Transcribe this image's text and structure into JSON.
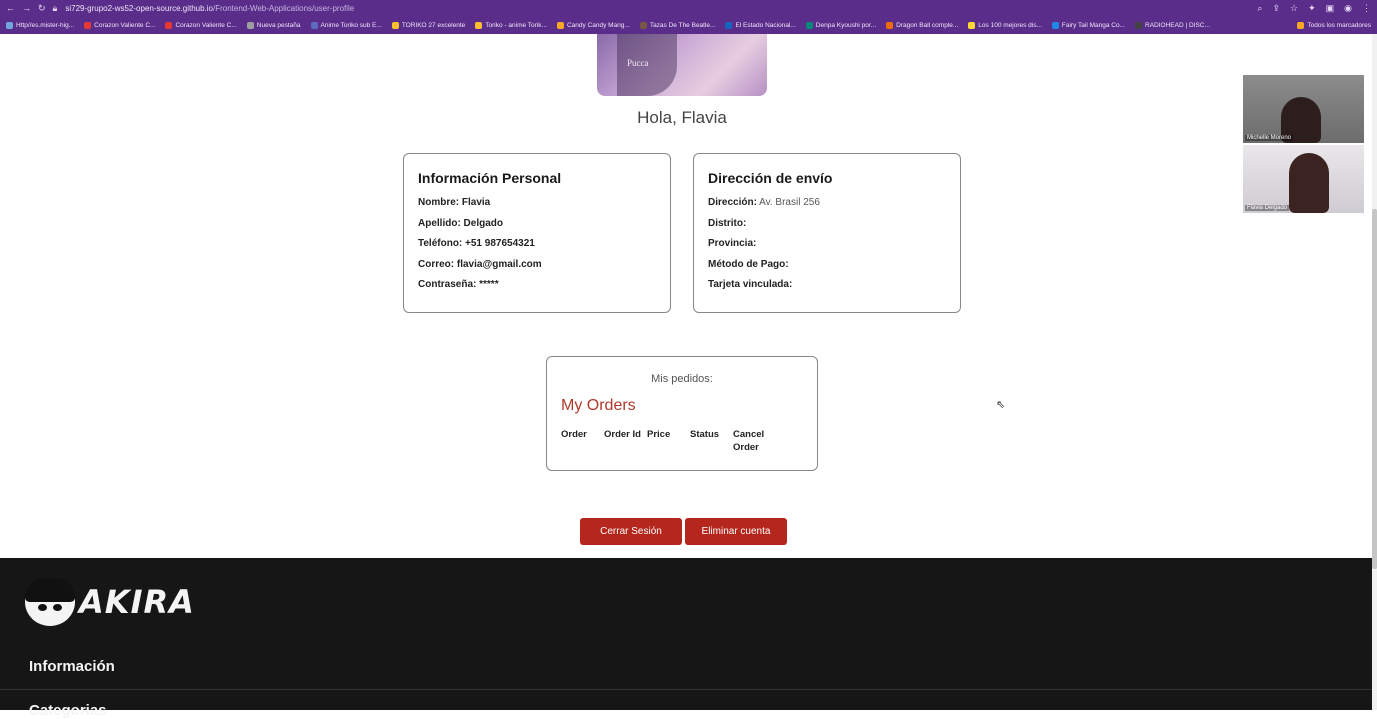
{
  "browser": {
    "url_host": "si729-grupo2-ws52-open-source.github.io",
    "url_path": "/Frontend-Web-Applications/user-profile",
    "bookmarks": [
      {
        "label": "Http//es.mister-hig...",
        "color": "#6fa8dc"
      },
      {
        "label": "Corazon Valiente C...",
        "color": "#e53935"
      },
      {
        "label": "Corazon Valiente C...",
        "color": "#e53935"
      },
      {
        "label": "Nueva pestaña",
        "color": "#9e9e9e"
      },
      {
        "label": "Anime Toriko sub E...",
        "color": "#5c6bc0"
      },
      {
        "label": "TORIKO 27 excelente",
        "color": "#fbc02d"
      },
      {
        "label": "Toriko - anime Torik...",
        "color": "#fbc02d"
      },
      {
        "label": "Candy Candy Mang...",
        "color": "#f9a825"
      },
      {
        "label": "Tazas De The Beatle...",
        "color": "#795548"
      },
      {
        "label": "El Estado Nacional...",
        "color": "#1565c0"
      },
      {
        "label": "Denpa Kyoushi por...",
        "color": "#00897b"
      },
      {
        "label": "Dragon Ball comple...",
        "color": "#ef6c00"
      },
      {
        "label": "Los 100 mejores dis...",
        "color": "#fdd835"
      },
      {
        "label": "Fairy Tail Manga Co...",
        "color": "#1e88e5"
      },
      {
        "label": "RADIOHEAD | DISC...",
        "color": "#424242"
      }
    ],
    "all_bookmarks_label": "Todos los marcadores"
  },
  "profile": {
    "avatar_caption": "Pucca",
    "greeting": "Hola, Flavia"
  },
  "personal_info": {
    "title": "Información Personal",
    "name_label": "Nombre: Flavia",
    "surname_label": "Apellido: Delgado",
    "phone_label": "Teléfono: +51 987654321",
    "email_label": "Correo: flavia@gmail.com",
    "password_label": "Contraseña: *****"
  },
  "shipping": {
    "title": "Dirección de envío",
    "address_label": "Dirección:",
    "address_value": " Av. Brasil 256",
    "district_label": "Distrito:",
    "province_label": "Provincia:",
    "payment_label": "Método de Pago:",
    "card_label": "Tarjeta vinculada:"
  },
  "orders": {
    "caption": "Mis pedidos:",
    "title": "My Orders",
    "columns": [
      "Order",
      "Order Id",
      "Price",
      "Status",
      "Cancel Order"
    ]
  },
  "actions": {
    "logout_label": "Cerrar Sesión",
    "delete_label": "Eliminar cuenta"
  },
  "footer": {
    "brand": "AKIRA",
    "info_label": "Información",
    "categories_label": "Categorias"
  },
  "video_call": {
    "participant_1": "Michelle Moreno",
    "participant_2": "Flavia Delgado"
  },
  "colors": {
    "browser_chrome": "#5a2d8a",
    "accent_red": "#b5261c",
    "orders_title": "#b0392b",
    "footer_bg": "#161616"
  }
}
